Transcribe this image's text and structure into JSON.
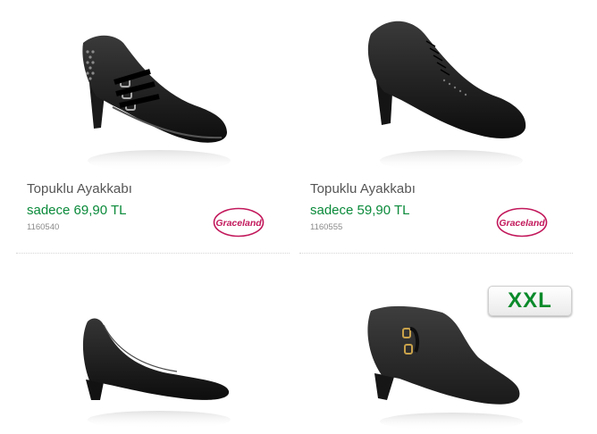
{
  "products": [
    {
      "name": "Topuklu Ayakkabı",
      "price": "sadece 69,90 TL",
      "sku": "1160540",
      "brand": "Graceland",
      "image_icon": "studded-buckle-bootie-image"
    },
    {
      "name": "Topuklu Ayakkabı",
      "price": "sadece 59,90 TL",
      "sku": "1160555",
      "brand": "Graceland",
      "image_icon": "lace-up-oxford-heel-image"
    },
    {
      "image_icon": "black-pump-image"
    },
    {
      "image_icon": "suede-buckle-bootie-image",
      "badge": "XXL"
    }
  ],
  "colors": {
    "price": "#0a8a3a",
    "brand": "#c2185b",
    "badge": "#0a8a2a"
  }
}
